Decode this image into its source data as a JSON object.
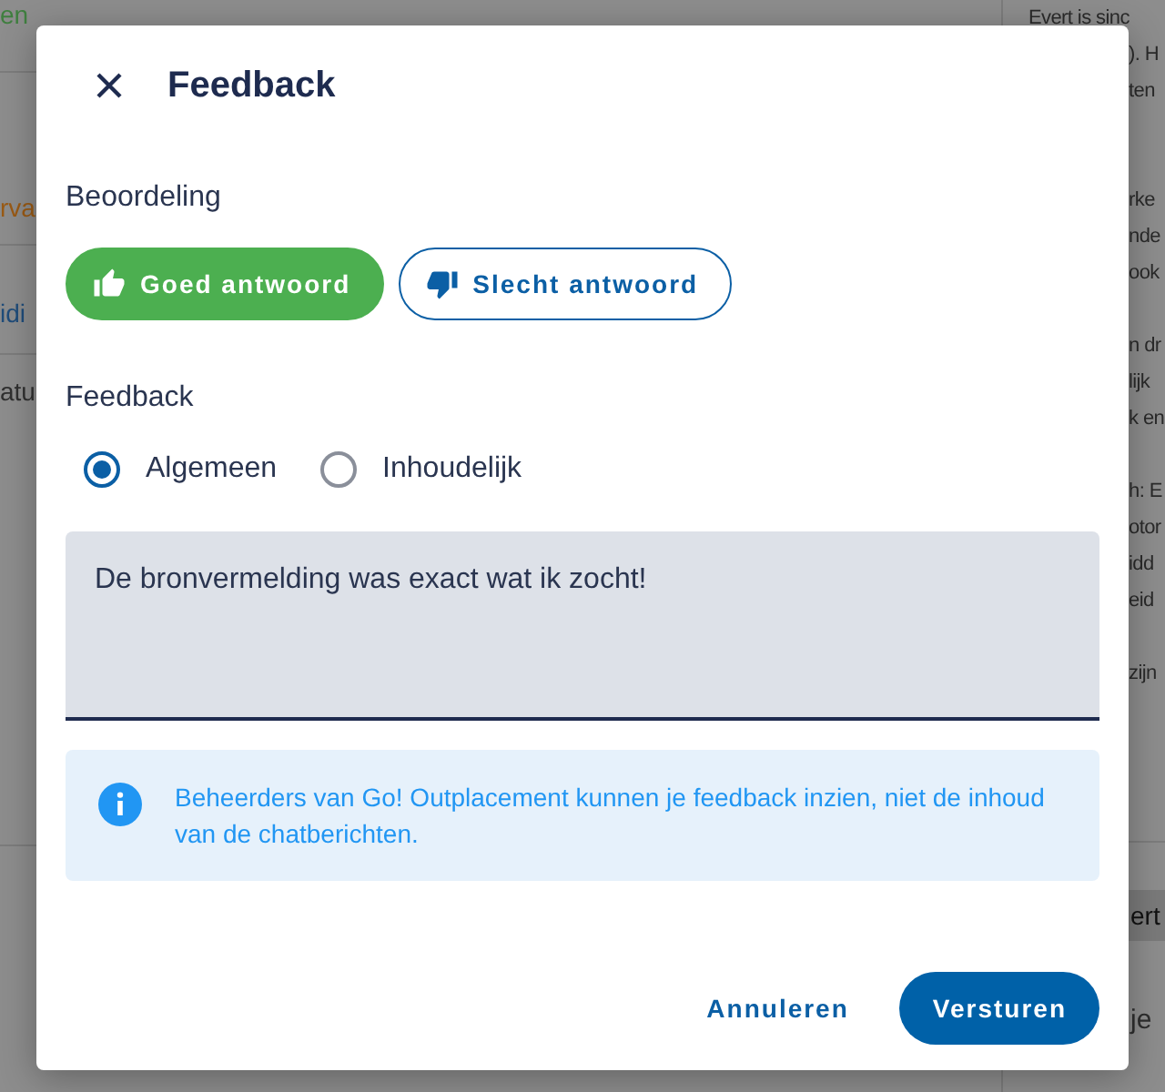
{
  "background": {
    "left_fragments": [
      {
        "text": "en",
        "color": "#3f7f3f"
      },
      {
        "text": "rva",
        "color": "#9a5a14"
      },
      {
        "text": "idi",
        "color": "#1f4c7a"
      },
      {
        "text": "atu",
        "color": "#303030"
      }
    ],
    "right_paragraphs": [
      [
        "Evert is sinc",
        "). H",
        "ten"
      ],
      [
        "rke",
        "nde",
        "ook"
      ],
      [
        "n dr",
        "lijk",
        "k en"
      ],
      [
        "h: E",
        "otor",
        "idd",
        "eid"
      ],
      [
        "zijn"
      ]
    ],
    "right_bar_text": "ert",
    "right_input_placeholder": "je"
  },
  "dialog": {
    "title": "Feedback",
    "rating": {
      "label": "Beoordeling",
      "options": [
        {
          "label": "Goed antwoord",
          "kind": "up",
          "selected": true
        },
        {
          "label": "Slecht antwoord",
          "kind": "down",
          "selected": false
        }
      ]
    },
    "feedback": {
      "label": "Feedback",
      "types": [
        {
          "label": "Algemeen",
          "selected": true
        },
        {
          "label": "Inhoudelijk",
          "selected": false
        }
      ],
      "value": "De bronvermelding was exact wat ik zocht!"
    },
    "info": "Beheerders van Go! Outplacement kunnen je feedback inzien, niet de inhoud van de chatberichten.",
    "buttons": [
      {
        "label": "Annuleren",
        "kind": "text"
      },
      {
        "label": "Versturen",
        "kind": "primary"
      }
    ]
  }
}
